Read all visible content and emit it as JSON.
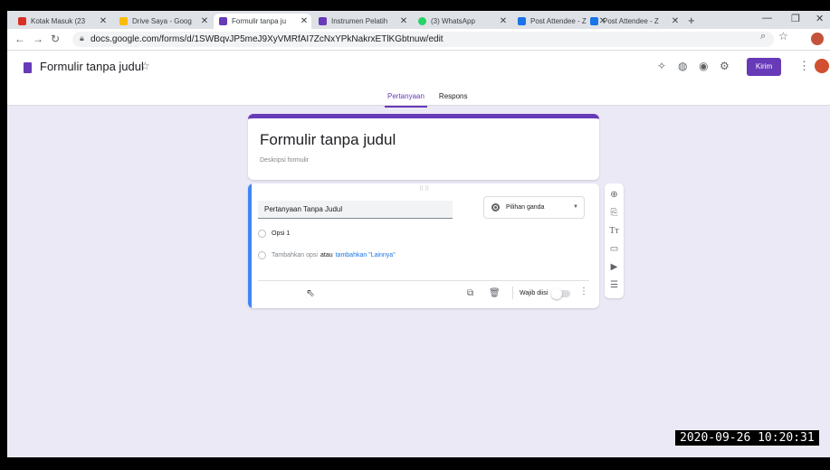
{
  "browser": {
    "tabs": [
      {
        "title": "Kotak Masuk (23",
        "favicon_color": "#d93025"
      },
      {
        "title": "Drive Saya - Goog",
        "favicon_color": "#fbbc04"
      },
      {
        "title": "Formulir tanpa ju",
        "favicon_color": "#673ab7"
      },
      {
        "title": "Instrumen Pelatih",
        "favicon_color": "#673ab7"
      },
      {
        "title": "(3) WhatsApp",
        "favicon_color": "#25d366"
      },
      {
        "title": "Post Attendee - Z",
        "favicon_color": "#1a73e8"
      },
      {
        "title": "Post Attendee - Z",
        "favicon_color": "#1a73e8"
      }
    ],
    "new_tab": "+",
    "url": "docs.google.com/forms/d/1SWBqvJP5meJ9XyVMRfAI7ZcNxYPkNakrxETlKGbtnuw/edit"
  },
  "form": {
    "doc_title": "Formulir tanpa judul",
    "send_label": "Kirim",
    "tabs": {
      "questions": "Pertanyaan",
      "responses": "Respons"
    },
    "title": "Formulir tanpa judul",
    "description": "Deskripsi formulir",
    "question": {
      "title": "Pertanyaan Tanpa Judul",
      "type": "Pilihan ganda",
      "option1": "Opsi 1",
      "add_option": "Tambahkan opsi",
      "or": "atau",
      "add_other": "tambahkan \"Lainnya\"",
      "required_label": "Wajib diisi",
      "required": false
    }
  },
  "timestamp": "2020-09-26 10:20:31"
}
